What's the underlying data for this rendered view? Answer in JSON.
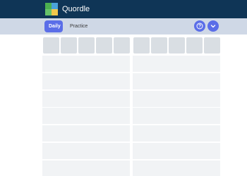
{
  "header": {
    "title": "Quordle",
    "logo_icon": "quordle-logo-icon",
    "background": "#0f3556"
  },
  "nav": {
    "tabs": [
      {
        "label": "Daily",
        "active": true
      },
      {
        "label": "Practice",
        "active": false
      }
    ],
    "help_icon": "question-circle-icon",
    "menu_icon": "chevron-down-icon",
    "accent": "#5b6ee8"
  },
  "boards": {
    "left": {
      "first_row_tiles": 5,
      "empty_rows": 7
    },
    "right": {
      "first_row_tiles": 5,
      "empty_rows": 7
    }
  }
}
